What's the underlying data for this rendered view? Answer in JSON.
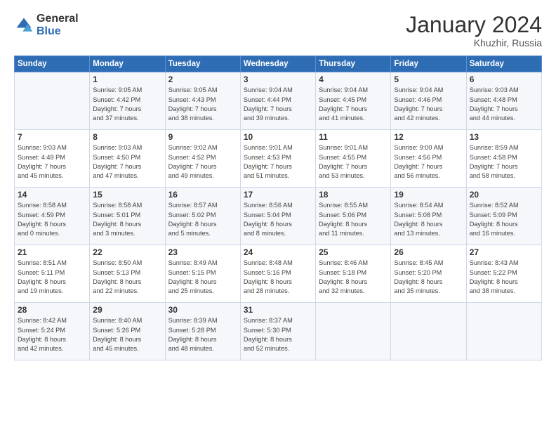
{
  "header": {
    "logo_general": "General",
    "logo_blue": "Blue",
    "month_title": "January 2024",
    "location": "Khuzhir, Russia"
  },
  "weekdays": [
    "Sunday",
    "Monday",
    "Tuesday",
    "Wednesday",
    "Thursday",
    "Friday",
    "Saturday"
  ],
  "weeks": [
    [
      {
        "day": "",
        "info": ""
      },
      {
        "day": "1",
        "info": "Sunrise: 9:05 AM\nSunset: 4:42 PM\nDaylight: 7 hours\nand 37 minutes."
      },
      {
        "day": "2",
        "info": "Sunrise: 9:05 AM\nSunset: 4:43 PM\nDaylight: 7 hours\nand 38 minutes."
      },
      {
        "day": "3",
        "info": "Sunrise: 9:04 AM\nSunset: 4:44 PM\nDaylight: 7 hours\nand 39 minutes."
      },
      {
        "day": "4",
        "info": "Sunrise: 9:04 AM\nSunset: 4:45 PM\nDaylight: 7 hours\nand 41 minutes."
      },
      {
        "day": "5",
        "info": "Sunrise: 9:04 AM\nSunset: 4:46 PM\nDaylight: 7 hours\nand 42 minutes."
      },
      {
        "day": "6",
        "info": "Sunrise: 9:03 AM\nSunset: 4:48 PM\nDaylight: 7 hours\nand 44 minutes."
      }
    ],
    [
      {
        "day": "7",
        "info": "Sunrise: 9:03 AM\nSunset: 4:49 PM\nDaylight: 7 hours\nand 45 minutes."
      },
      {
        "day": "8",
        "info": "Sunrise: 9:03 AM\nSunset: 4:50 PM\nDaylight: 7 hours\nand 47 minutes."
      },
      {
        "day": "9",
        "info": "Sunrise: 9:02 AM\nSunset: 4:52 PM\nDaylight: 7 hours\nand 49 minutes."
      },
      {
        "day": "10",
        "info": "Sunrise: 9:01 AM\nSunset: 4:53 PM\nDaylight: 7 hours\nand 51 minutes."
      },
      {
        "day": "11",
        "info": "Sunrise: 9:01 AM\nSunset: 4:55 PM\nDaylight: 7 hours\nand 53 minutes."
      },
      {
        "day": "12",
        "info": "Sunrise: 9:00 AM\nSunset: 4:56 PM\nDaylight: 7 hours\nand 56 minutes."
      },
      {
        "day": "13",
        "info": "Sunrise: 8:59 AM\nSunset: 4:58 PM\nDaylight: 7 hours\nand 58 minutes."
      }
    ],
    [
      {
        "day": "14",
        "info": "Sunrise: 8:58 AM\nSunset: 4:59 PM\nDaylight: 8 hours\nand 0 minutes."
      },
      {
        "day": "15",
        "info": "Sunrise: 8:58 AM\nSunset: 5:01 PM\nDaylight: 8 hours\nand 3 minutes."
      },
      {
        "day": "16",
        "info": "Sunrise: 8:57 AM\nSunset: 5:02 PM\nDaylight: 8 hours\nand 5 minutes."
      },
      {
        "day": "17",
        "info": "Sunrise: 8:56 AM\nSunset: 5:04 PM\nDaylight: 8 hours\nand 8 minutes."
      },
      {
        "day": "18",
        "info": "Sunrise: 8:55 AM\nSunset: 5:06 PM\nDaylight: 8 hours\nand 11 minutes."
      },
      {
        "day": "19",
        "info": "Sunrise: 8:54 AM\nSunset: 5:08 PM\nDaylight: 8 hours\nand 13 minutes."
      },
      {
        "day": "20",
        "info": "Sunrise: 8:52 AM\nSunset: 5:09 PM\nDaylight: 8 hours\nand 16 minutes."
      }
    ],
    [
      {
        "day": "21",
        "info": "Sunrise: 8:51 AM\nSunset: 5:11 PM\nDaylight: 8 hours\nand 19 minutes."
      },
      {
        "day": "22",
        "info": "Sunrise: 8:50 AM\nSunset: 5:13 PM\nDaylight: 8 hours\nand 22 minutes."
      },
      {
        "day": "23",
        "info": "Sunrise: 8:49 AM\nSunset: 5:15 PM\nDaylight: 8 hours\nand 25 minutes."
      },
      {
        "day": "24",
        "info": "Sunrise: 8:48 AM\nSunset: 5:16 PM\nDaylight: 8 hours\nand 28 minutes."
      },
      {
        "day": "25",
        "info": "Sunrise: 8:46 AM\nSunset: 5:18 PM\nDaylight: 8 hours\nand 32 minutes."
      },
      {
        "day": "26",
        "info": "Sunrise: 8:45 AM\nSunset: 5:20 PM\nDaylight: 8 hours\nand 35 minutes."
      },
      {
        "day": "27",
        "info": "Sunrise: 8:43 AM\nSunset: 5:22 PM\nDaylight: 8 hours\nand 38 minutes."
      }
    ],
    [
      {
        "day": "28",
        "info": "Sunrise: 8:42 AM\nSunset: 5:24 PM\nDaylight: 8 hours\nand 42 minutes."
      },
      {
        "day": "29",
        "info": "Sunrise: 8:40 AM\nSunset: 5:26 PM\nDaylight: 8 hours\nand 45 minutes."
      },
      {
        "day": "30",
        "info": "Sunrise: 8:39 AM\nSunset: 5:28 PM\nDaylight: 8 hours\nand 48 minutes."
      },
      {
        "day": "31",
        "info": "Sunrise: 8:37 AM\nSunset: 5:30 PM\nDaylight: 8 hours\nand 52 minutes."
      },
      {
        "day": "",
        "info": ""
      },
      {
        "day": "",
        "info": ""
      },
      {
        "day": "",
        "info": ""
      }
    ]
  ],
  "colors": {
    "header_bg": "#2e6db4",
    "odd_row": "#f5f7fa",
    "even_row": "#ffffff",
    "border": "#d0d8e8"
  }
}
